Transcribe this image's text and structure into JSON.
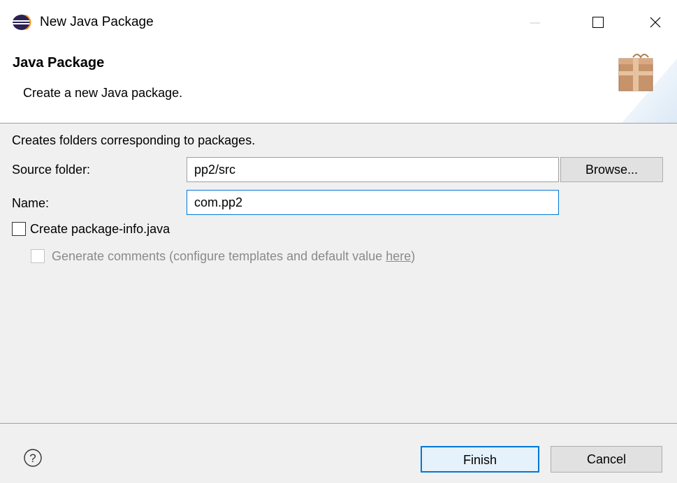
{
  "window": {
    "title": "New Java Package",
    "icons": {
      "app": "eclipse-icon",
      "minimize": "minimize-icon",
      "maximize": "maximize-icon",
      "close": "close-icon"
    }
  },
  "header": {
    "title": "Java Package",
    "description": "Create a new Java package.",
    "graphic": "package-wizard-icon"
  },
  "body": {
    "description": "Creates folders corresponding to packages.",
    "source_folder": {
      "label": "Source folder:",
      "value": "pp2/src",
      "browse_label": "Browse..."
    },
    "name": {
      "label": "Name:",
      "value": "com.pp2"
    },
    "create_package_info": {
      "label": "Create package-info.java",
      "checked": false
    },
    "generate_comments": {
      "label_prefix": "Generate comments (configure templates and default value ",
      "link_text": "here",
      "label_suffix": ")",
      "checked": false,
      "enabled": false
    }
  },
  "footer": {
    "help_icon": "help-icon",
    "finish_label": "Finish",
    "cancel_label": "Cancel"
  },
  "colors": {
    "accent": "#0078d7",
    "dialog_bg": "#f0f0f0",
    "button_bg": "#e1e1e1",
    "disabled_text": "#8a8a8a"
  }
}
